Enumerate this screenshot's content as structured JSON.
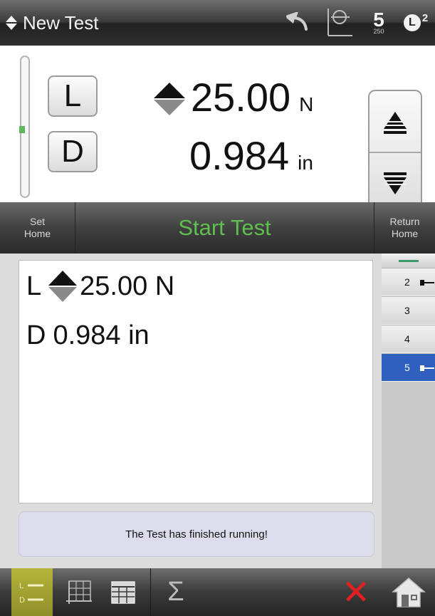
{
  "title_bar": {
    "title": "New Test",
    "speed_value": "5",
    "speed_sub": "250",
    "l2_letter": "L",
    "l2_sup": "2",
    "icons": [
      "updown-arrow-icon",
      "undo-icon",
      "tare-icon",
      "speed-icon",
      "l2-icon"
    ]
  },
  "readout": {
    "load_key": "L",
    "disp_key": "D",
    "load_value": "25.00",
    "load_unit": "N",
    "disp_value": "0.984",
    "disp_unit": "in",
    "position_fraction": 0.52,
    "icons": [
      "direction-updown-icon",
      "jog-up-icon",
      "jog-down-icon"
    ]
  },
  "action_bar": {
    "set_home_line1": "Set",
    "set_home_line2": "Home",
    "start_label": "Start Test",
    "return_home_line1": "Return",
    "return_home_line2": "Home"
  },
  "results": {
    "load_prefix": "L",
    "load_text": "25.00 N",
    "disp_prefix": "D",
    "disp_text": "0.984 in",
    "status": "The Test has finished running!"
  },
  "test_list": {
    "items": [
      {
        "label": "2",
        "selected": false,
        "marked": true
      },
      {
        "label": "3",
        "selected": false,
        "marked": false
      },
      {
        "label": "4",
        "selected": false,
        "marked": false
      },
      {
        "label": "5",
        "selected": true,
        "marked": true
      }
    ]
  },
  "bottom_bar": {
    "ld_line1": "L",
    "ld_line2": "D",
    "sigma": "Σ",
    "cancel": "✕",
    "icons": [
      "ld-icon",
      "graph-icon",
      "table-icon",
      "sigma-icon",
      "cancel-icon",
      "home-icon"
    ]
  },
  "colors": {
    "start_green": "#5fbf4f",
    "selected_blue": "#2f5fbf",
    "cancel_red": "#e02020",
    "status_bg": "#dcdcec",
    "ld_yellow": "#b4b43a"
  }
}
